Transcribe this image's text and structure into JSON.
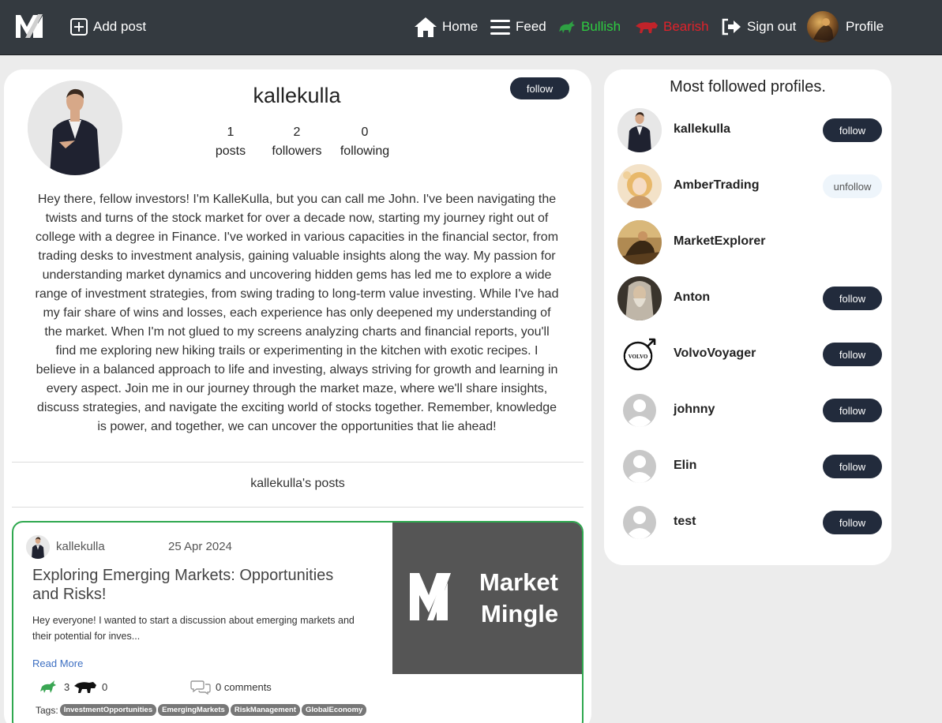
{
  "nav": {
    "logo_icon": "market-mingle-logo",
    "add_post": "Add post",
    "home": "Home",
    "feed": "Feed",
    "bullish": "Bullish",
    "bearish": "Bearish",
    "sign_out": "Sign out",
    "profile": "Profile",
    "colors": {
      "bar": "#343a40",
      "bullish": "#2ecc40",
      "bearish": "#e0222a"
    }
  },
  "profile": {
    "username": "kallekulla",
    "follow_label": "follow",
    "stats": [
      {
        "value": "1",
        "label": "posts"
      },
      {
        "value": "2",
        "label": "followers"
      },
      {
        "value": "0",
        "label": "following"
      }
    ],
    "bio": "Hey there, fellow investors! I'm KalleKulla, but you can call me John. I've been navigating the twists and turns of the stock market for over a decade now, starting my journey right out of college with a degree in Finance. I've worked in various capacities in the financial sector, from trading desks to investment analysis, gaining valuable insights along the way. My passion for understanding market dynamics and uncovering hidden gems has led me to explore a wide range of investment strategies, from swing trading to long-term value investing. While I've had my fair share of wins and losses, each experience has only deepened my understanding of the market. When I'm not glued to my screens analyzing charts and financial reports, you'll find me exploring new hiking trails or experimenting in the kitchen with exotic recipes. I believe in a balanced approach to life and investing, always striving for growth and learning in every aspect. Join me in our journey through the market maze, where we'll share insights, discuss strategies, and navigate the exciting world of stocks together. Remember, knowledge is power, and together, we can uncover the opportunities that lie ahead!",
    "posts_heading": "kallekulla's posts"
  },
  "post": {
    "author": "kallekulla",
    "date": "25 Apr 2024",
    "title": "Exploring Emerging Markets: Opportunities and Risks!",
    "excerpt": "Hey everyone! I wanted to start a discussion about emerging markets and their potential for inves...",
    "read_more": "Read More",
    "bullish_count": "3",
    "bearish_count": "0",
    "comments": "0 comments",
    "tags_label": "Tags:",
    "tags": [
      "InvestmentOpportunities",
      "EmergingMarkets",
      "RiskManagement",
      "GlobalEconomy"
    ],
    "image_text": {
      "line1": "Market",
      "line2": "Mingle"
    },
    "border_color": "#2fa84f"
  },
  "sidebar": {
    "title": "Most followed profiles.",
    "profiles": [
      {
        "name": "kallekulla",
        "action": "follow"
      },
      {
        "name": "AmberTrading",
        "action": "unfollow"
      },
      {
        "name": "MarketExplorer",
        "action": ""
      },
      {
        "name": "Anton",
        "action": "follow"
      },
      {
        "name": "VolvoVoyager",
        "action": "follow"
      },
      {
        "name": "johnny",
        "action": "follow"
      },
      {
        "name": "Elin",
        "action": "follow"
      },
      {
        "name": "test",
        "action": "follow"
      }
    ],
    "volvo_logo_text": "VOLVO"
  }
}
